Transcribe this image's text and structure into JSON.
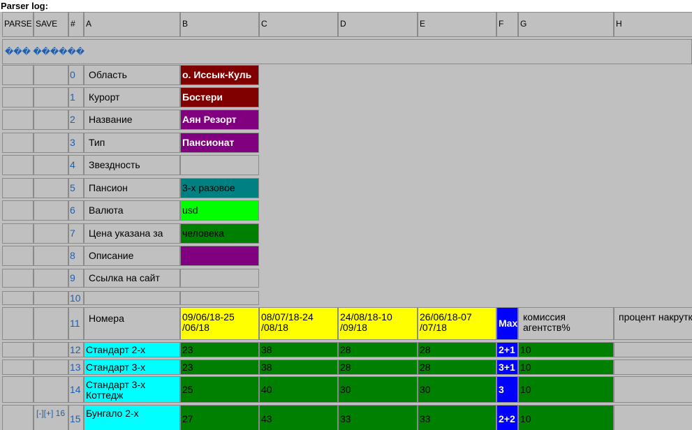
{
  "title": "Parser log:",
  "message": "��� ������",
  "columns": [
    "PARSE",
    "SAVE",
    "#",
    "A",
    "B",
    "C",
    "D",
    "E",
    "F",
    "G",
    "H"
  ],
  "colors": {
    "dark_red": "#800000",
    "purple": "#800080",
    "teal": "#008080",
    "lime": "#00ff00",
    "green": "#008000",
    "yellow": "#ffff00",
    "blue": "#0000ff",
    "cyan": "#00ffff",
    "gray": "#c0c0c0"
  },
  "rows": [
    {
      "num": "0",
      "label": "Область",
      "value": "о. Иссык-Куль"
    },
    {
      "num": "1",
      "label": "Курорт",
      "value": "Бостери"
    },
    {
      "num": "2",
      "label": "Название",
      "value": "Аян Резорт"
    },
    {
      "num": "3",
      "label": "Тип",
      "value": "Пансионат"
    },
    {
      "num": "4",
      "label": "Звездность",
      "value": ""
    },
    {
      "num": "5",
      "label": "Пансион",
      "value": "3-х разовое"
    },
    {
      "num": "6",
      "label": "Валюта",
      "value": "usd"
    },
    {
      "num": "7",
      "label": "Цена указана за",
      "value": "человека"
    },
    {
      "num": "8",
      "label": "Описание",
      "value": ""
    },
    {
      "num": "9",
      "label": "Ссылка на сайт",
      "value": ""
    },
    {
      "num": "10",
      "label": "",
      "value": ""
    }
  ],
  "header_row": {
    "num": "11",
    "label": "Номера",
    "periods": [
      "09/06/18-25 /06/18",
      "08/07/18-24 /08/18",
      "24/08/18-10 /09/18",
      "26/06/18-07 /07/18"
    ],
    "max": "Max",
    "commission": "комиссия агентств%",
    "markup": "процент накрутки"
  },
  "rooms": [
    {
      "num": "12",
      "name": "Стандарт 2-х",
      "prices": [
        "23",
        "38",
        "28",
        "28"
      ],
      "max": "2+1",
      "commission": "10",
      "save": ""
    },
    {
      "num": "13",
      "name": "Стандарт 3-х",
      "prices": [
        "23",
        "38",
        "28",
        "28"
      ],
      "max": "3+1",
      "commission": "10",
      "save": ""
    },
    {
      "num": "14",
      "name": "Стандарт 3-х Коттедж",
      "prices": [
        "25",
        "40",
        "30",
        "30"
      ],
      "max": "3",
      "commission": "10",
      "save": ""
    },
    {
      "num": "15",
      "name": "Бунгало 2-х",
      "prices": [
        "27",
        "43",
        "33",
        "33"
      ],
      "max": "2+2",
      "commission": "10",
      "save": "[-][+] 16"
    }
  ]
}
